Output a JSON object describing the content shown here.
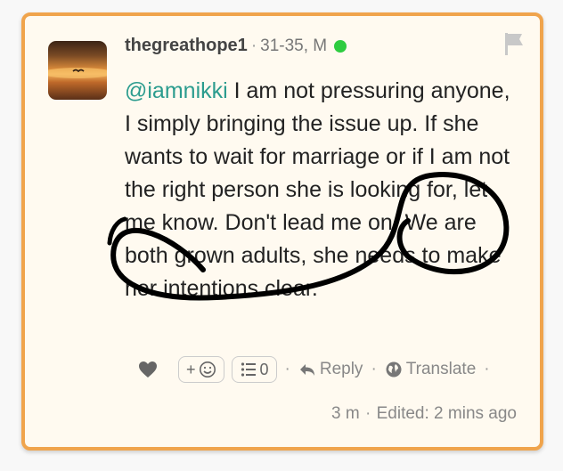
{
  "comment": {
    "username": "thegreathope1",
    "meta_separator": "·",
    "age_gender": "31-35, M",
    "mention": "@iamnikki",
    "body": " I am not pressuring anyone, I simply bringing the issue up. If she wants to wait for marriage or if I am not the right person she is looking for, let me know. Don't lead me on. We are both grown adults, she needs to make her intentions clear.",
    "time": "3 m",
    "edited": "Edited: 2 mins ago",
    "footer_separator": "·"
  },
  "actions": {
    "add_reaction_label": "+",
    "poll_count": "0",
    "reply_label": "Reply",
    "translate_label": "Translate",
    "separator": "·"
  },
  "icons": {
    "flag": "flag-icon",
    "heart": "heart-icon",
    "smiley": "smiley-icon",
    "list": "list-icon",
    "reply": "reply-arrow-icon",
    "globe": "globe-icon"
  },
  "colors": {
    "card_border": "#f0a44c",
    "card_background": "#fffaf0",
    "mention": "#2b9c8e",
    "online": "#2ecc40"
  }
}
